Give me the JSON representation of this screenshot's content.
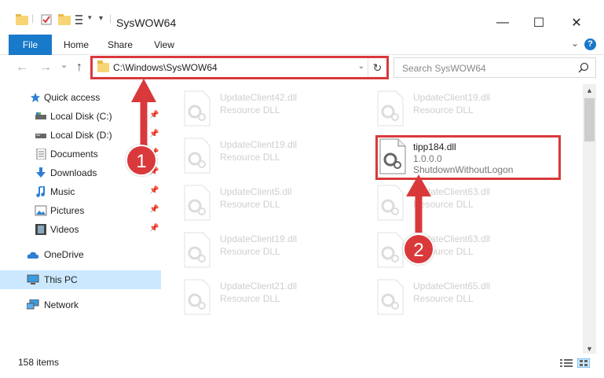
{
  "window": {
    "title": "SysWOW64",
    "minimize_glyph": "—",
    "maximize_glyph": "☐",
    "close_glyph": "✕"
  },
  "ribbon": {
    "tabs": [
      {
        "label": "File"
      },
      {
        "label": "Home"
      },
      {
        "label": "Share"
      },
      {
        "label": "View"
      }
    ],
    "expand_glyph": "⌄",
    "help_glyph": "?"
  },
  "nav": {
    "back_glyph": "←",
    "forward_glyph": "→",
    "recent_glyph": "⌄",
    "up_glyph": "↑",
    "address": "C:\\Windows\\SysWOW64",
    "dropdown_glyph": "⌄",
    "refresh_glyph": "↻",
    "search_placeholder": "Search SysWOW64"
  },
  "sidebar": {
    "items": [
      {
        "label": "Quick access",
        "icon": "star-icon"
      },
      {
        "label": "Local Disk (C:)",
        "icon": "drive-icon",
        "pinned": true
      },
      {
        "label": "Local Disk (D:)",
        "icon": "drive-icon",
        "pinned": true
      },
      {
        "label": "Documents",
        "icon": "documents-icon",
        "pinned": true
      },
      {
        "label": "Downloads",
        "icon": "download-icon",
        "pinned": true
      },
      {
        "label": "Music",
        "icon": "music-icon",
        "pinned": true
      },
      {
        "label": "Pictures",
        "icon": "pictures-icon",
        "pinned": true
      },
      {
        "label": "Videos",
        "icon": "videos-icon",
        "pinned": true
      },
      {
        "label": "OneDrive",
        "icon": "cloud-icon"
      },
      {
        "label": "This PC",
        "icon": "computer-icon",
        "selected": true
      },
      {
        "label": "Network",
        "icon": "network-icon"
      }
    ],
    "pin_glyph": "📌"
  },
  "files": {
    "left": [
      {
        "name": "UpdateClient42.dll",
        "type": "Resource DLL"
      },
      {
        "name": "UpdateClient19.dll",
        "type": "Resource DLL"
      },
      {
        "name": "UpdateClient5.dll",
        "type": "Resource DLL"
      },
      {
        "name": "UpdateClient19.dll",
        "type": "Resource DLL"
      },
      {
        "name": "UpdateClient21.dll",
        "type": "Resource DLL"
      }
    ],
    "right": [
      {
        "name": "UpdateClient19.dll",
        "type": "Resource DLL"
      },
      {
        "name": "tipp184.dll",
        "version": "1.0.0.0",
        "description": "ShutdownWithoutLogon",
        "active": true
      },
      {
        "name": "UpdateClient63.dll",
        "type": "Resource DLL"
      },
      {
        "name": "UpdateClient63.dll",
        "type": "Resource DLL"
      },
      {
        "name": "UpdateClient65.dll",
        "type": "Resource DLL"
      }
    ]
  },
  "status": {
    "item_count": "158 items"
  },
  "annotations": {
    "marker1": "1",
    "marker2": "2"
  },
  "colors": {
    "accent": "#1979ca",
    "highlight": "#d9393b",
    "selected_bg": "#cce8ff"
  }
}
